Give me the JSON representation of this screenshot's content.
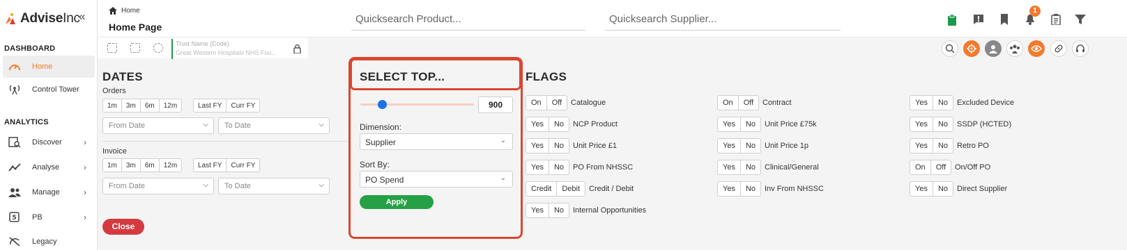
{
  "brand": {
    "name_bold": "Advise",
    "name_light": "Inc"
  },
  "sidebar": {
    "collapse_glyph": "«",
    "sections": [
      {
        "title": "DASHBOARD"
      },
      {
        "title": "ANALYTICS"
      }
    ],
    "items": [
      {
        "label": "Home",
        "icon": "gauge-icon",
        "active": true
      },
      {
        "label": "Control Tower",
        "icon": "antenna-icon"
      },
      {
        "label": "Discover",
        "icon": "discover-icon"
      },
      {
        "label": "Analyse",
        "icon": "trend-icon"
      },
      {
        "label": "Manage",
        "icon": "users-icon"
      },
      {
        "label": "PB",
        "icon": "pb-icon"
      },
      {
        "label": "Legacy",
        "icon": "legacy-icon"
      }
    ]
  },
  "header": {
    "breadcrumb": "Home",
    "title": "Home Page",
    "product_search_placeholder": "Quicksearch Product...",
    "supplier_search_placeholder": "Quicksearch Supplier...",
    "notification_count": "1"
  },
  "trust": {
    "label": "Trust Name (Code)",
    "value": "Great Western Hospitals NHS Fou..."
  },
  "dates": {
    "title": "DATES",
    "orders_label": "Orders",
    "invoice_label": "Invoice",
    "quick_ranges": [
      "1m",
      "3m",
      "6m",
      "12m"
    ],
    "fy_ranges": [
      "Last FY",
      "Curr FY"
    ],
    "from_placeholder": "From Date",
    "to_placeholder": "To Date",
    "close_label": "Close"
  },
  "select_top": {
    "title": "SELECT TOP...",
    "value": "900",
    "slider_fraction": 0.19,
    "dimension_label": "Dimension:",
    "dimension_value": "Supplier",
    "sort_label": "Sort By:",
    "sort_value": "PO Spend",
    "apply_label": "Apply"
  },
  "flags": {
    "title": "FLAGS",
    "items": [
      {
        "label": "Catalogue",
        "options": [
          "On",
          "Off"
        ]
      },
      {
        "label": "NCP Product",
        "options": [
          "Yes",
          "No"
        ]
      },
      {
        "label": "Unit Price £1",
        "options": [
          "Yes",
          "No"
        ]
      },
      {
        "label": "PO From NHSSC",
        "options": [
          "Yes",
          "No"
        ]
      },
      {
        "label": "Credit / Debit",
        "options": [
          "Credit",
          "Debit"
        ]
      },
      {
        "label": "Internal Opportunities",
        "options": [
          "Yes",
          "No"
        ]
      },
      {
        "label": "Contract",
        "options": [
          "On",
          "Off"
        ]
      },
      {
        "label": "Unit Price £75k",
        "options": [
          "Yes",
          "No"
        ]
      },
      {
        "label": "Unit Price 1p",
        "options": [
          "Yes",
          "No"
        ]
      },
      {
        "label": "Clinical/General",
        "options": [
          "Yes",
          "No"
        ]
      },
      {
        "label": "Inv From NHSSC",
        "options": [
          "Yes",
          "No"
        ]
      },
      {
        "label": "Excluded Device",
        "options": [
          "Yes",
          "No"
        ]
      },
      {
        "label": "SSDP (HCTED)",
        "options": [
          "Yes",
          "No"
        ]
      },
      {
        "label": "Retro PO",
        "options": [
          "Yes",
          "No"
        ]
      },
      {
        "label": "On/Off PO",
        "options": [
          "On",
          "Off"
        ]
      },
      {
        "label": "Direct Supplier",
        "options": [
          "Yes",
          "No"
        ]
      }
    ]
  },
  "colors": {
    "accent": "#f07b2e",
    "highlight": "#d9472f",
    "apply": "#26a046",
    "close": "#d43a3f"
  }
}
